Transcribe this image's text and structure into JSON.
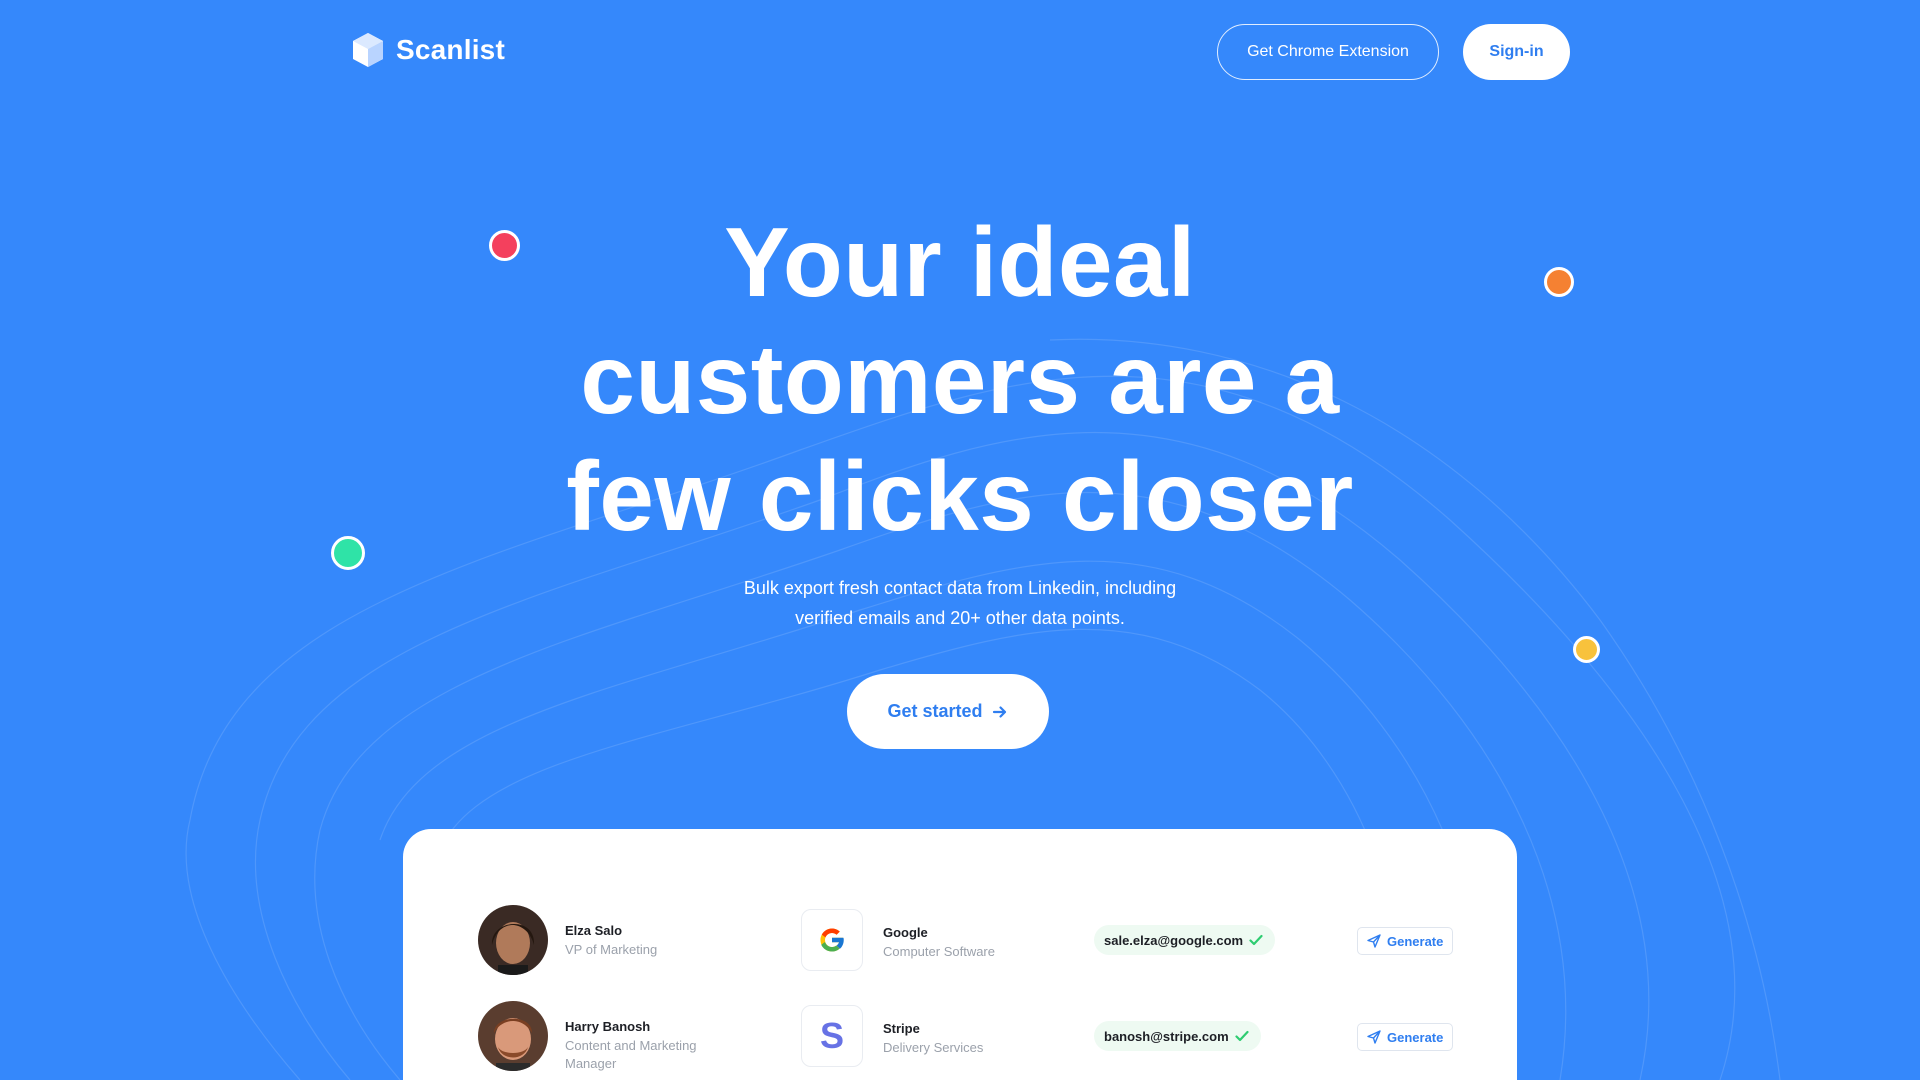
{
  "brand": {
    "name": "Scanlist"
  },
  "header": {
    "extension_label": "Get Chrome Extension",
    "signin_label": "Sign-in"
  },
  "hero": {
    "headline_line1": "Your ideal",
    "headline_line2": "customers are a",
    "headline_line3": "few clicks closer",
    "subtext_line1": "Bulk export fresh contact data from Linkedin, including",
    "subtext_line2": "verified emails and 20+ other data points.",
    "cta_label": "Get started"
  },
  "colors": {
    "background": "#3588fb",
    "accent_text": "#2f7ef0",
    "dot_red": "#f4405d",
    "dot_orange": "#f58132",
    "dot_green": "#2fe3a7",
    "dot_yellow": "#f8c23c",
    "verified_check": "#2ecc71"
  },
  "contacts": [
    {
      "name": "Elza Salo",
      "role": "VP of Marketing",
      "company": "Google",
      "industry": "Computer Software",
      "company_icon": "google-icon",
      "email": "sale.elza@google.com",
      "action_label": "Generate"
    },
    {
      "name": "Harry Banosh",
      "role": "Content and Marketing Manager",
      "company": "Stripe",
      "industry": "Delivery Services",
      "company_icon": "stripe-icon",
      "email": "banosh@stripe.com",
      "action_label": "Generate"
    }
  ]
}
